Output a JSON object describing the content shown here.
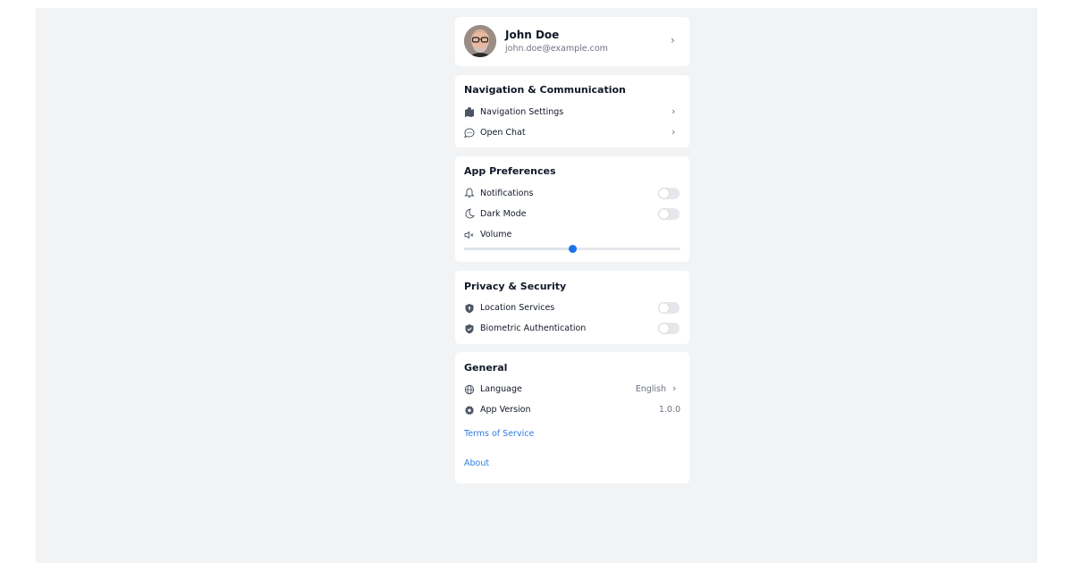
{
  "profile": {
    "name": "John Doe",
    "email": "john.doe@example.com",
    "chevron": "›"
  },
  "navigation": {
    "title": "Navigation & Communication",
    "items": [
      {
        "label": "Navigation Settings",
        "icon": "map-icon",
        "chevron": "›"
      },
      {
        "label": "Open Chat",
        "icon": "chat-icon",
        "chevron": "›"
      }
    ]
  },
  "preferences": {
    "title": "App Preferences",
    "notifications": {
      "label": "Notifications",
      "icon": "bell-icon",
      "on": false
    },
    "dark_mode": {
      "label": "Dark Mode",
      "icon": "moon-icon",
      "on": false
    },
    "volume": {
      "label": "Volume",
      "icon": "volume-mute-icon",
      "value": 0.5
    }
  },
  "privacy": {
    "title": "Privacy & Security",
    "location": {
      "label": "Location Services",
      "icon": "shield-icon",
      "on": false
    },
    "biometric": {
      "label": "Biometric Authentication",
      "icon": "shield-check-icon",
      "on": false
    }
  },
  "general": {
    "title": "General",
    "language": {
      "label": "Language",
      "value": "English",
      "icon": "globe-icon",
      "chevron": "›"
    },
    "version": {
      "label": "App Version",
      "value": "1.0.0",
      "icon": "gear-icon"
    },
    "terms": "Terms of Service",
    "about": "About"
  },
  "colors": {
    "background": "#f2f3f5",
    "card": "#ffffff",
    "accent": "#1a73e8",
    "link": "#2f7de1",
    "toggle_off": "#e5e7eb"
  }
}
